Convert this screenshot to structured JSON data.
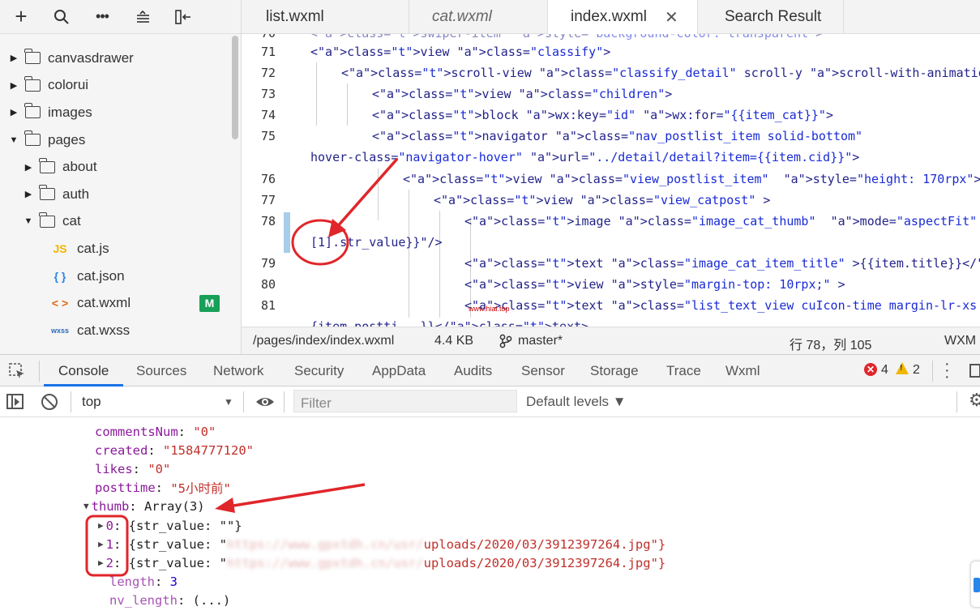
{
  "sidebar": {
    "tree": [
      {
        "label": "canvasdrawer",
        "type": "folder",
        "expanded": false,
        "depth": 0
      },
      {
        "label": "colorui",
        "type": "folder",
        "expanded": false,
        "depth": 0
      },
      {
        "label": "images",
        "type": "folder",
        "expanded": false,
        "depth": 0
      },
      {
        "label": "pages",
        "type": "folder",
        "expanded": true,
        "depth": 0
      },
      {
        "label": "about",
        "type": "folder",
        "expanded": false,
        "depth": 1
      },
      {
        "label": "auth",
        "type": "folder",
        "expanded": false,
        "depth": 1
      },
      {
        "label": "cat",
        "type": "folder",
        "expanded": true,
        "depth": 1
      },
      {
        "label": "cat.js",
        "type": "file",
        "icon": "JS",
        "depth": 2
      },
      {
        "label": "cat.json",
        "type": "file",
        "icon": "{ }",
        "depth": 2
      },
      {
        "label": "cat.wxml",
        "type": "file",
        "icon": "< >",
        "depth": 2,
        "badge": "M"
      },
      {
        "label": "cat.wxss",
        "type": "file",
        "icon": "wxss",
        "depth": 2
      }
    ]
  },
  "editor": {
    "tabs": [
      {
        "label": "list.wxml",
        "italic": false,
        "active": false
      },
      {
        "label": "cat.wxml",
        "italic": true,
        "active": false
      },
      {
        "label": "index.wxml",
        "italic": false,
        "active": true
      },
      {
        "label": "Search Result",
        "italic": false,
        "active": false
      }
    ],
    "close_glyph": "✕",
    "lines": [
      {
        "num": "70",
        "text": "<swiper-item  style=\"background-color: transparent\">"
      },
      {
        "num": "71",
        "text": "<view class=\"classify\">"
      },
      {
        "num": "72",
        "text": "<scroll-view class=\"classify_detail\" scroll-y scroll-with-animation=\"true\">"
      },
      {
        "num": "73",
        "text": "<view class=\"children\">"
      },
      {
        "num": "74",
        "text": "<block wx:key=\"id\" wx:for=\"{{item_cat}}\">"
      },
      {
        "num": "75",
        "text": "<navigator class=\"nav_postlist_item solid-bottom\""
      },
      {
        "num": "",
        "text": "hover-class=\"navigator-hover\" url=\"../detail/detail?item={{item.cid}}\">"
      },
      {
        "num": "76",
        "text": "<view class=\"view_postlist_item\"  style=\"height: 170rpx\">"
      },
      {
        "num": "77",
        "text": "<view class=\"view_catpost\" >"
      },
      {
        "num": "78",
        "text": "<image class=\"image_cat_thumb\"  mode=\"aspectFit\" src=\"{{item.thumb"
      },
      {
        "num": "",
        "text": "[1].str_value}}\"/>"
      },
      {
        "num": "79",
        "text": "<text class=\"image_cat_item_title\" >{{item.title}}</text>"
      },
      {
        "num": "80",
        "text": "<view style=\"margin-top: 10rpx;\" >"
      },
      {
        "num": "81",
        "text": "<text class=\"list_text_view cuIcon-time margin-lr-xs \" >{"
      },
      {
        "num": "",
        "text": "{item.postti...}}</text>"
      }
    ],
    "watermark": "www.hiai.top",
    "status": {
      "path": "/pages/index/index.wxml",
      "size": "4.4 KB",
      "branch": "master*",
      "cursor": "行 78，列 105",
      "lang": "WXM"
    }
  },
  "devtools": {
    "tabs": [
      "Console",
      "Sources",
      "Network",
      "Security",
      "AppData",
      "Audits",
      "Sensor",
      "Storage",
      "Trace",
      "Wxml"
    ],
    "active_tab": "Console",
    "errors": "4",
    "warnings": "2",
    "context": "top",
    "filter_placeholder": "Filter",
    "levels": "Default levels ▼"
  },
  "console": {
    "lines": [
      {
        "key": "commentsNum",
        "value": "\"0\""
      },
      {
        "key": "created",
        "value": "\"1584777120\""
      },
      {
        "key": "likes",
        "value": "\"0\""
      },
      {
        "key": "posttime",
        "value": "\"5小时前\""
      },
      {
        "key": "thumb",
        "value": "Array(3)"
      },
      {
        "key": "0",
        "value": "{str_value: \"\"}"
      },
      {
        "key": "1",
        "value_pre": "{str_value: \"",
        "value_blur": "https://www.gpxtdh.cn/usr/",
        "value_post": "uploads/2020/03/3912397264.jpg\"}"
      },
      {
        "key": "2",
        "value_pre": "{str_value: \"",
        "value_blur": "https://www.gpxtdh.cn/usr/",
        "value_post": "uploads/2020/03/3912397264.jpg\"}"
      },
      {
        "key": "length",
        "value": "3"
      },
      {
        "key": "nv_length",
        "value": "(...)"
      }
    ]
  },
  "colors": {
    "accent": "#1a73e8",
    "annotation": "#e0262a",
    "badge_m": "#18a058"
  }
}
